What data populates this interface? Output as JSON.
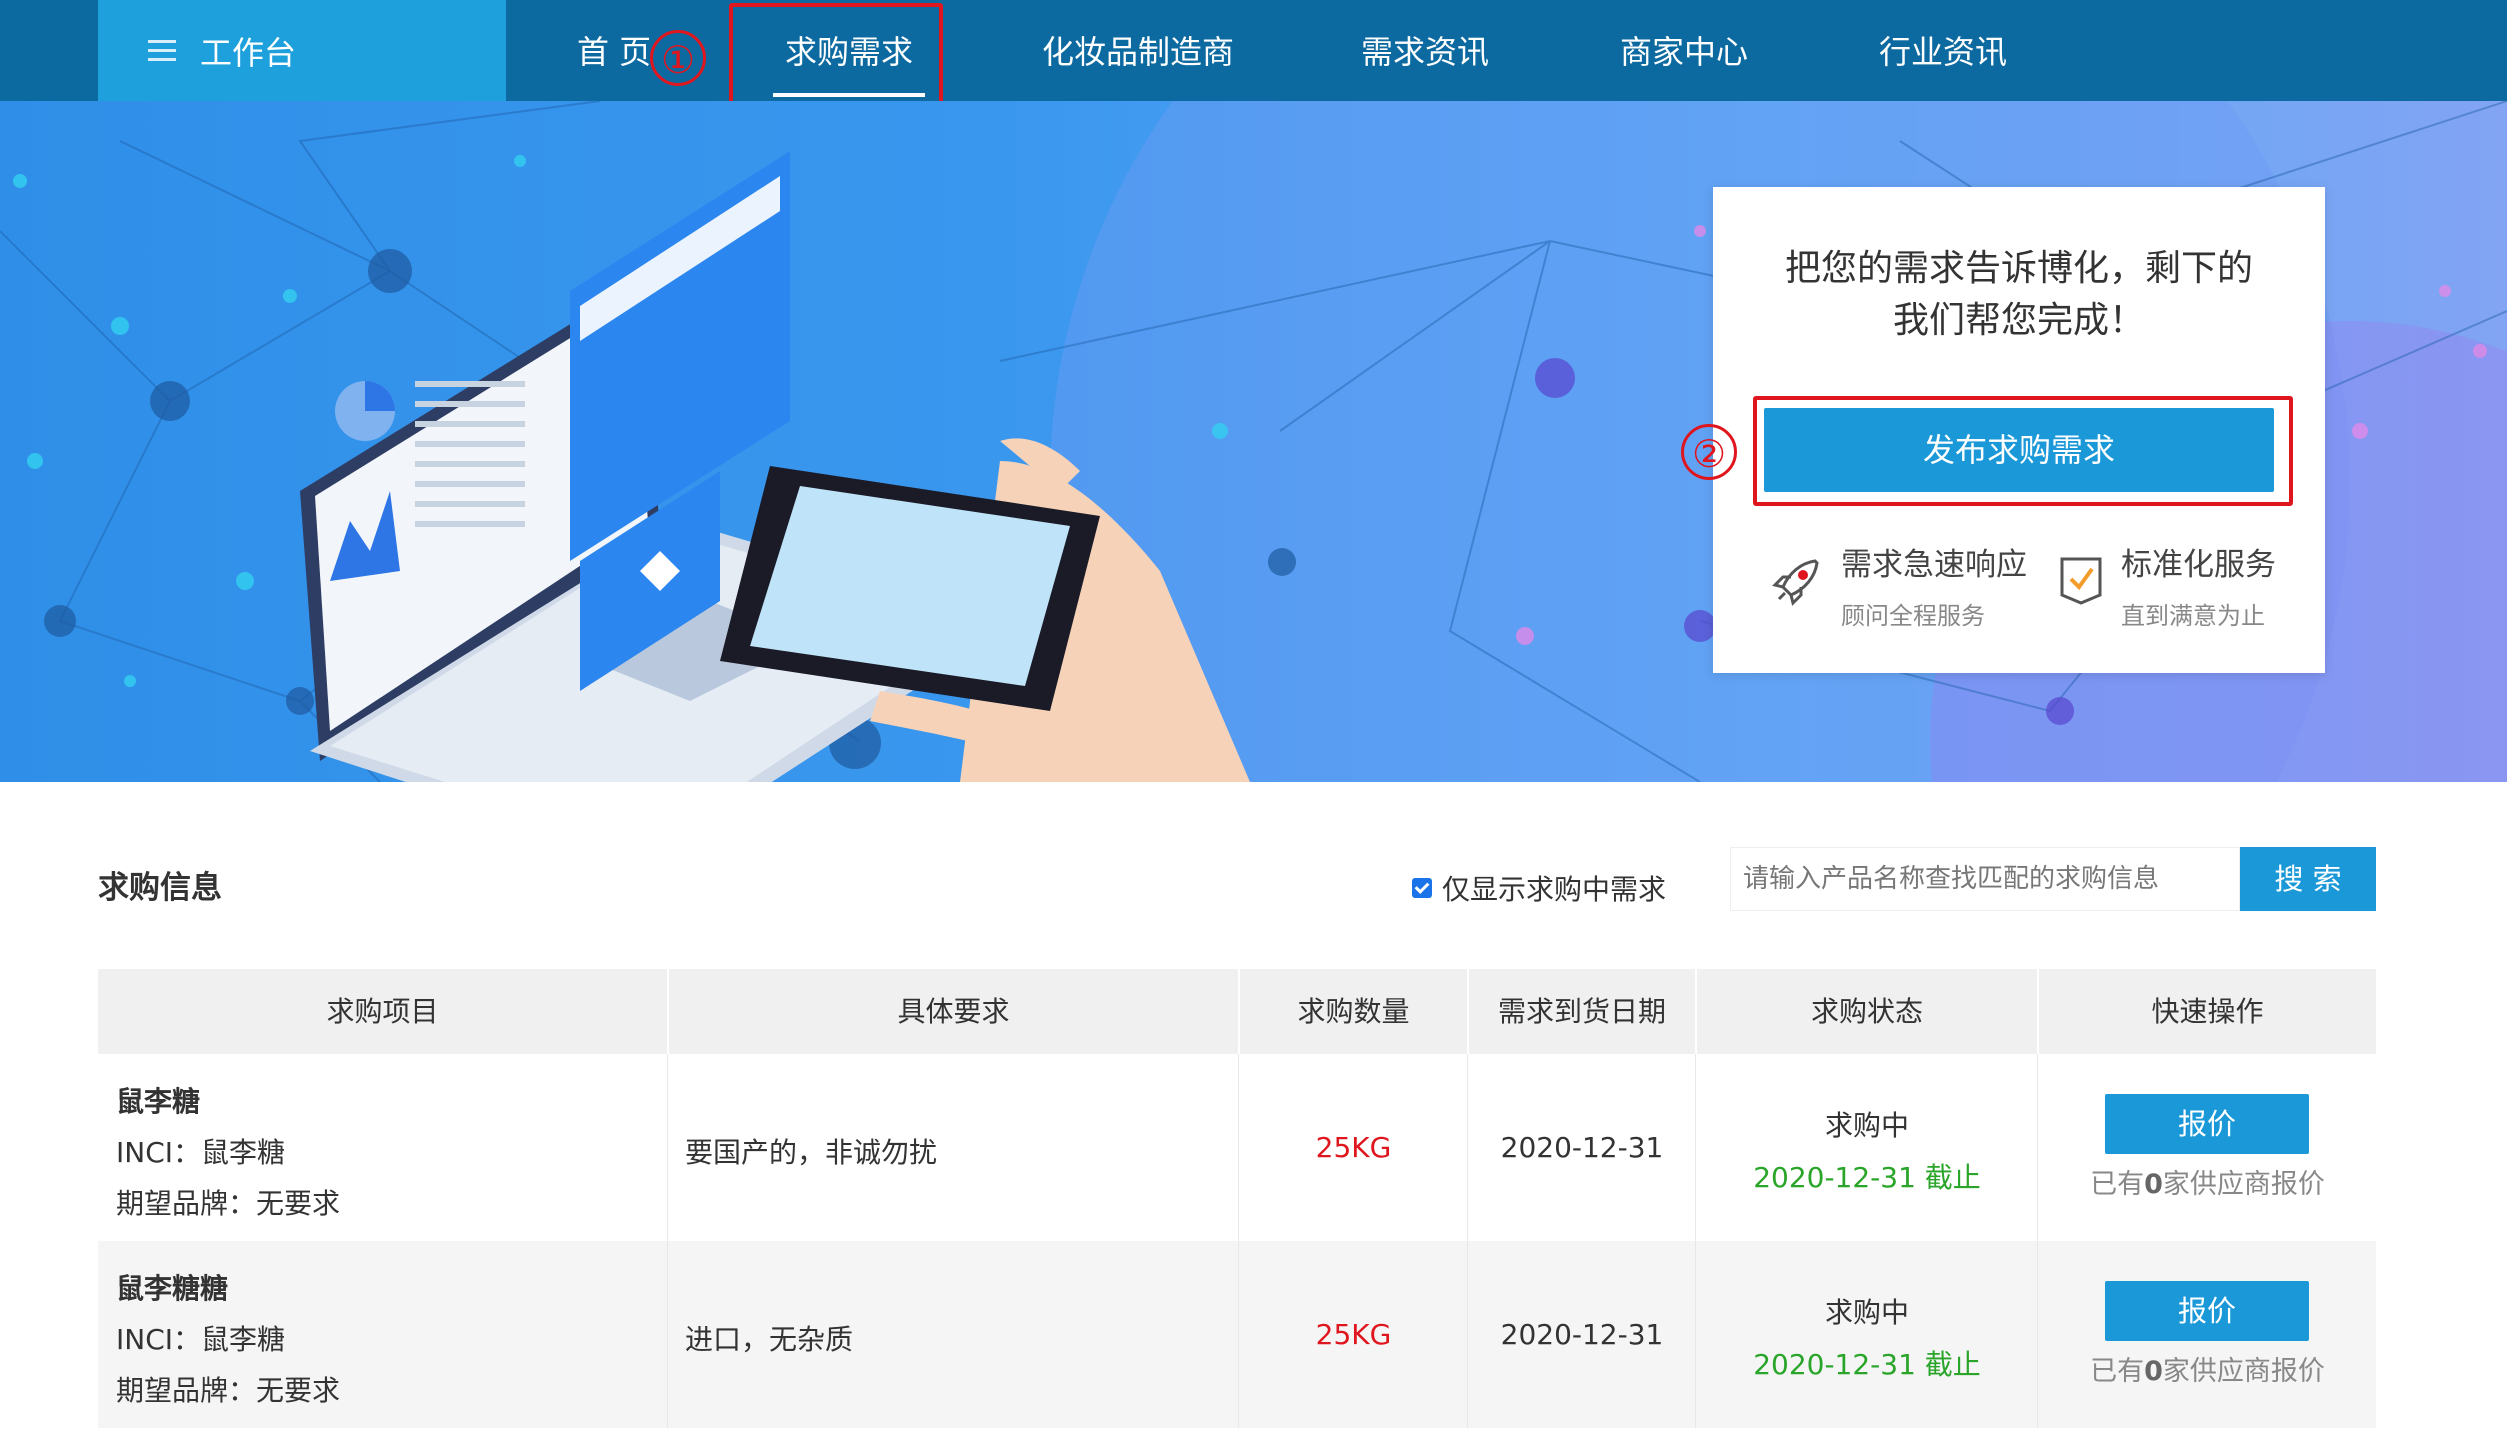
{
  "nav": {
    "workbench_label": "工作台",
    "items": [
      {
        "label": "首 页"
      },
      {
        "label": "求购需求"
      },
      {
        "label": "化妆品制造商"
      },
      {
        "label": "需求资讯"
      },
      {
        "label": "商家中心"
      },
      {
        "label": "行业资讯"
      }
    ],
    "active": "求购需求"
  },
  "annotations": {
    "step1": "①",
    "step2": "②"
  },
  "promo": {
    "line1": "把您的需求告诉博化，剩下的",
    "line2": "我们帮您完成！",
    "publish_label": "发布求购需求",
    "features": [
      {
        "icon": "rocket-icon",
        "title": "需求急速响应",
        "subtitle": "顾问全程服务"
      },
      {
        "icon": "checklist-icon",
        "title": "标准化服务",
        "subtitle": "直到满意为止"
      }
    ]
  },
  "section": {
    "title": "求购信息"
  },
  "filter": {
    "checkbox_label": "仅显示求购中需求",
    "checked": true
  },
  "search": {
    "placeholder": "请输入产品名称查找匹配的求购信息",
    "button_label": "搜 索"
  },
  "table": {
    "headers": [
      "求购项目",
      "具体要求",
      "求购数量",
      "需求到货日期",
      "求购状态",
      "快速操作"
    ],
    "rows": [
      {
        "name": "鼠李糖",
        "inci": "INCI：鼠李糖",
        "brand": "期望品牌：无要求",
        "requirement": "要国产的，非诚勿扰",
        "qty": "25KG",
        "date": "2020-12-31",
        "status": "求购中",
        "deadline": "2020-12-31 截止",
        "quote_label": "报价",
        "quote_prefix": "已有",
        "quote_count": "0",
        "quote_suffix": "家供应商报价"
      },
      {
        "name": "鼠李糖糖",
        "inci": "INCI：鼠李糖",
        "brand": "期望品牌：无要求",
        "requirement": "进口，无杂质",
        "qty": "25KG",
        "date": "2020-12-31",
        "status": "求购中",
        "deadline": "2020-12-31 截止",
        "quote_label": "报价",
        "quote_prefix": "已有",
        "quote_count": "0",
        "quote_suffix": "家供应商报价"
      }
    ]
  },
  "colors": {
    "nav_bg": "#0c6aa0",
    "workbench_bg": "#1ea0dc",
    "accent": "#1a98d8",
    "annotation_red": "#e0161e",
    "qty_red": "#e0161e",
    "deadline_green": "#2aa52a"
  }
}
